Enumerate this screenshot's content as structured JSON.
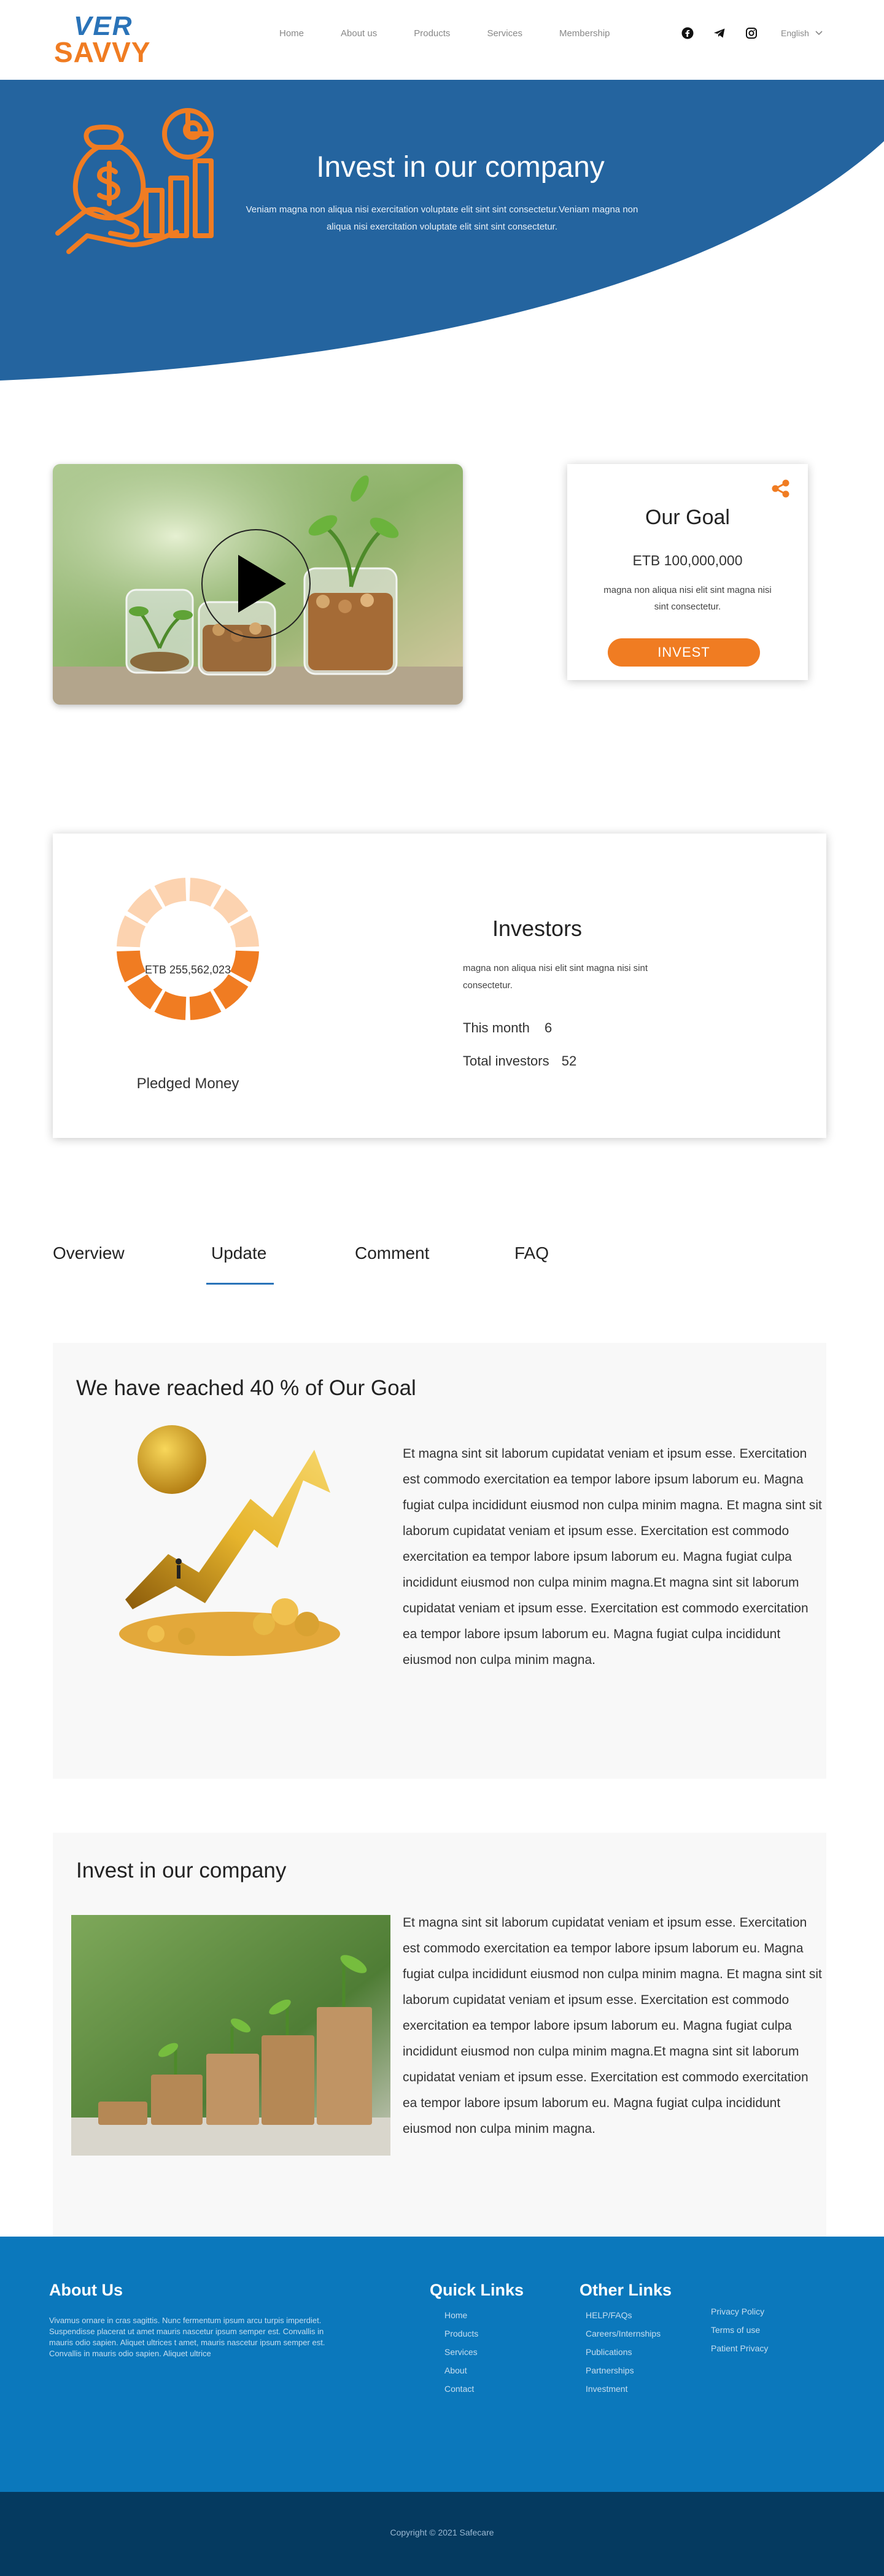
{
  "brand": {
    "line1": "VER",
    "line2": "SAVVY",
    "primary_color": "#2a73b8",
    "accent_color": "#f07c22"
  },
  "nav": {
    "items": [
      "Home",
      "About us",
      "Products",
      "Services",
      "Membership"
    ],
    "social_icons": [
      "facebook-icon",
      "telegram-icon",
      "instagram-icon"
    ],
    "language": "English"
  },
  "hero": {
    "title": "Invest in our company",
    "subtitle": "Veniam magna non aliqua nisi exercitation voluptate elit sint sint consectetur.Veniam magna non aliqua nisi exercitation voluptate elit sint sint consectetur.",
    "background_color": "#24649f"
  },
  "goal": {
    "title": "Our Goal",
    "amount": "ETB 100,000,000",
    "description": "magna non aliqua nisi  elit sint magna nisi sint consectetur.",
    "button": "INVEST"
  },
  "investors": {
    "donut_label": "ETB  255,562,023",
    "donut_segments_total": 12,
    "donut_segments_filled": 6,
    "pledged_label": "Pledged Money",
    "title": "Investors",
    "description": "magna non aliqua nisi  elit sint magna nisi sint consectetur.",
    "this_month_label": "This  month",
    "this_month_value": "6",
    "total_label": "Total investors",
    "total_value": "52"
  },
  "tabs": {
    "items": [
      "Overview",
      "Update",
      "Comment",
      "FAQ"
    ],
    "active": "Update"
  },
  "update": {
    "title": "We have reached  40 % of Our Goal",
    "body": "Et magna sint sit laborum cupidatat veniam et ipsum esse. Exercitation est commodo exercitation ea tempor labore ipsum laborum eu. Magna fugiat culpa incididunt eiusmod non culpa minim magna. Et magna sint sit laborum cupidatat veniam et ipsum esse. Exercitation est commodo exercitation ea tempor labore ipsum laborum eu. Magna fugiat culpa incididunt eiusmod non culpa minim magna.Et magna sint sit laborum cupidatat veniam et ipsum esse. Exercitation est commodo exercitation ea tempor labore ipsum laborum eu. Magna fugiat culpa incididunt eiusmod non culpa minim magna."
  },
  "invest_section": {
    "title": "Invest in our company",
    "body": "Et magna sint sit laborum cupidatat veniam et ipsum esse. Exercitation est commodo exercitation ea tempor labore ipsum laborum eu. Magna fugiat culpa incididunt eiusmod non culpa minim magna. Et magna sint sit laborum cupidatat veniam et ipsum esse. Exercitation est commodo exercitation ea tempor labore ipsum laborum eu. Magna fugiat culpa incididunt eiusmod non culpa minim magna.Et magna sint sit laborum cupidatat veniam et ipsum esse. Exercitation est commodo exercitation ea tempor labore ipsum laborum eu. Magna fugiat culpa incididunt eiusmod non culpa minim magna."
  },
  "footer": {
    "about_title": "About Us",
    "about_text": "Vivamus ornare in cras sagittis. Nunc fermentum ipsum arcu turpis imperdiet. Suspendisse placerat ut amet mauris nascetur ipsum semper est. Convallis in mauris odio sapien. Aliquet ultrices t amet, mauris nascetur ipsum semper est. Convallis in mauris odio sapien. Aliquet ultrice",
    "quick_title": "Quick Links",
    "quick_links": [
      "Home",
      "Products",
      "Services",
      "About",
      "Contact"
    ],
    "other_title": "Other Links",
    "other_links": [
      "HELP/FAQs",
      "Careers/Internships",
      "Publications",
      "Partnerships",
      "Investment"
    ],
    "policy_links": [
      "Privacy Policy",
      "Terms of use",
      "Patient Privacy"
    ],
    "copyright": "Copyright © 2021 Safecare"
  }
}
